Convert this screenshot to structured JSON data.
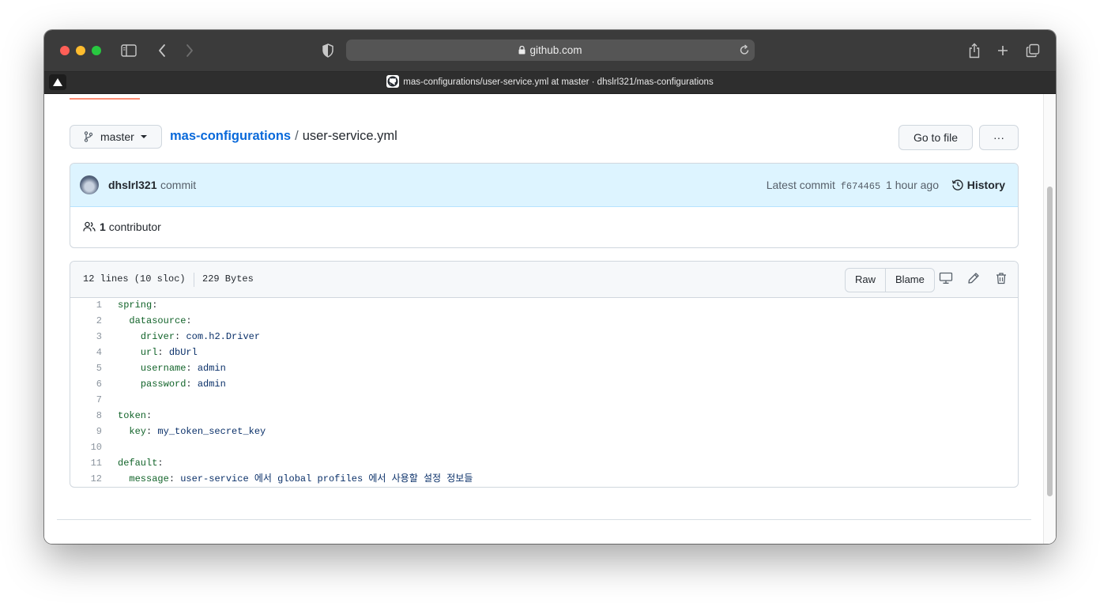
{
  "browser": {
    "url": "github.com",
    "tab_title": "mas-configurations/user-service.yml at master · dhslrl321/mas-configurations"
  },
  "repo": {
    "branch": "master",
    "repo_name": "mas-configurations",
    "separator": "/",
    "file_name": "user-service.yml",
    "go_to_file": "Go to file",
    "more": "···"
  },
  "commit": {
    "author": "dhslrl321",
    "message": "commit",
    "latest_label": "Latest commit",
    "sha": "f674465",
    "time": "1 hour ago",
    "history": "History",
    "contributors_count": "1",
    "contributors_label": "contributor"
  },
  "file": {
    "lines_info": "12 lines (10 sloc)",
    "size": "229 Bytes",
    "raw": "Raw",
    "blame": "Blame"
  },
  "code_lines": [
    {
      "n": "1",
      "indent": "",
      "key": "spring",
      "sep": ":",
      "val": ""
    },
    {
      "n": "2",
      "indent": "  ",
      "key": "datasource",
      "sep": ":",
      "val": ""
    },
    {
      "n": "3",
      "indent": "    ",
      "key": "driver",
      "sep": ": ",
      "val": "com.h2.Driver"
    },
    {
      "n": "4",
      "indent": "    ",
      "key": "url",
      "sep": ": ",
      "val": "dbUrl"
    },
    {
      "n": "5",
      "indent": "    ",
      "key": "username",
      "sep": ": ",
      "val": "admin"
    },
    {
      "n": "6",
      "indent": "    ",
      "key": "password",
      "sep": ": ",
      "val": "admin"
    },
    {
      "n": "7",
      "indent": "",
      "key": "",
      "sep": "",
      "val": ""
    },
    {
      "n": "8",
      "indent": "",
      "key": "token",
      "sep": ":",
      "val": ""
    },
    {
      "n": "9",
      "indent": "  ",
      "key": "key",
      "sep": ": ",
      "val": "my_token_secret_key"
    },
    {
      "n": "10",
      "indent": "",
      "key": "",
      "sep": "",
      "val": ""
    },
    {
      "n": "11",
      "indent": "",
      "key": "default",
      "sep": ":",
      "val": ""
    },
    {
      "n": "12",
      "indent": "  ",
      "key": "message",
      "sep": ": ",
      "val": "user-service 에서 global profiles 에서 사용할 설정 정보들"
    }
  ]
}
